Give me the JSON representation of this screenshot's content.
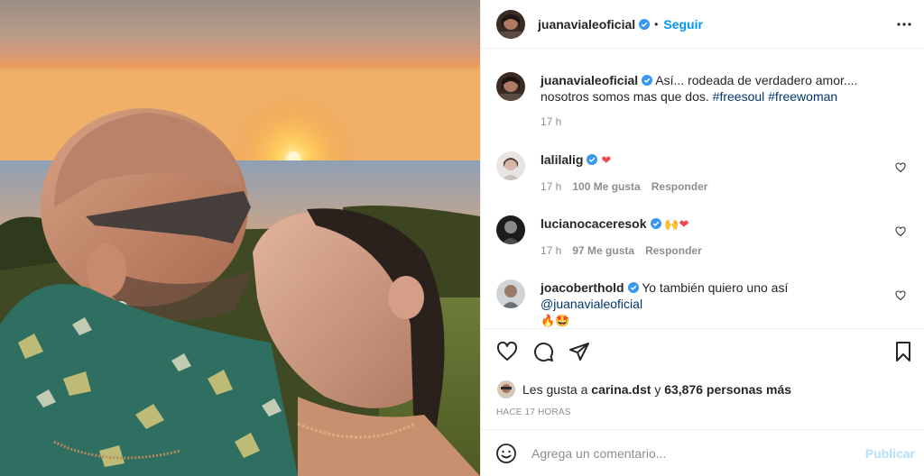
{
  "header": {
    "username": "juanavialeoficial",
    "separator": "•",
    "follow_label": "Seguir",
    "more_icon": "more-horizontal-icon"
  },
  "caption": {
    "username": "juanavialeoficial",
    "text": "Así... rodeada de verdadero amor.... nosotros somos mas que dos.",
    "hashtags": [
      "#freesoul",
      "#freewoman"
    ],
    "time": "17 h"
  },
  "comments": [
    {
      "username": "lalilalig",
      "verified": true,
      "text": "",
      "emoji": "❤",
      "time": "17 h",
      "likes": "100 Me gusta",
      "reply": "Responder"
    },
    {
      "username": "lucianocaceresok",
      "verified": true,
      "text": "",
      "emoji": "🙌❤",
      "time": "17 h",
      "likes": "97 Me gusta",
      "reply": "Responder"
    },
    {
      "username": "joacoberthold",
      "verified": true,
      "text": "Yo también quiero uno así",
      "mention": "@juanavialeoficial",
      "emoji": "🔥🤩"
    }
  ],
  "actions": {
    "like_icon": "heart-icon",
    "comment_icon": "comment-icon",
    "share_icon": "send-icon",
    "save_icon": "bookmark-icon"
  },
  "likes": {
    "prefix": "Les gusta a",
    "user": "carina.dst",
    "joiner": "y",
    "others": "63,876 personas más"
  },
  "timestamp": "HACE 17 HORAS",
  "add_comment": {
    "placeholder": "Agrega un comentario...",
    "publish_label": "Publicar"
  },
  "colors": {
    "accent": "#0095f6",
    "verified": "#3897f0",
    "heart_red": "#ed4956",
    "publish_disabled": "#b2dffc",
    "muted": "#8e8e8e"
  }
}
